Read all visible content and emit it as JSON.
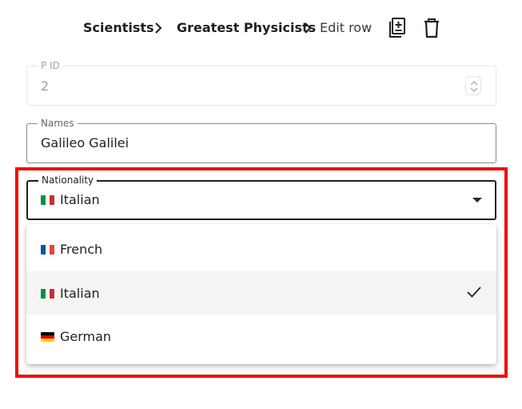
{
  "breadcrumb": {
    "items": [
      "Scientists",
      "Greatest Physicists"
    ],
    "current": "Edit row"
  },
  "toolbar": {
    "icons": [
      "duplicate-row-icon",
      "delete-icon"
    ]
  },
  "form": {
    "pid": {
      "label": "P ID",
      "value": "2",
      "disabled": true
    },
    "names": {
      "label": "Names",
      "value": "Galileo Galilei"
    },
    "nationality": {
      "label": "Nationality",
      "value": "Italian",
      "flag": "it"
    }
  },
  "dropdown": {
    "options": [
      {
        "label": "French",
        "flag": "fr",
        "selected": false
      },
      {
        "label": "Italian",
        "flag": "it",
        "selected": true
      },
      {
        "label": "German",
        "flag": "de",
        "selected": false
      }
    ]
  },
  "colors": {
    "highlight": "#f00d0d",
    "selected_option_bg": "#f4f4f4",
    "italy": [
      "#009246",
      "#ffffff",
      "#ce2b37"
    ],
    "france": [
      "#0055a4",
      "#ffffff",
      "#ef4135"
    ],
    "germany": [
      "#000000",
      "#dd0000",
      "#ffce00"
    ]
  }
}
